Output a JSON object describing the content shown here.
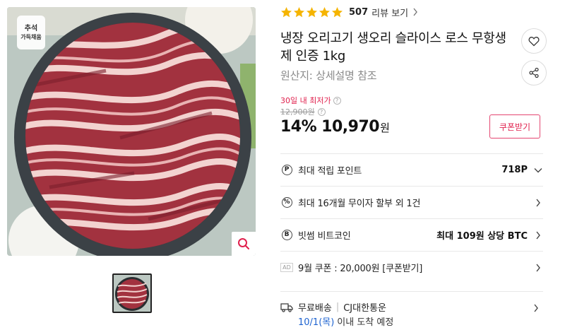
{
  "gallery": {
    "badge_line1": "추석",
    "badge_line2": "가득채움",
    "zoom_icon": "magnifier-icon"
  },
  "product": {
    "rating": 5,
    "review_count": "507",
    "review_link": "리뷰 보기",
    "title": "냉장 오리고기 생오리 슬라이스 로스 무항생제 인증 1kg",
    "origin": "원산지: 상세설명 참조",
    "lowest_label": "30일 내 최저가",
    "original_price": "12,900원",
    "discount": "14%",
    "price": "10,970",
    "currency": "원",
    "coupon_button": "쿠폰받기"
  },
  "benefits": [
    {
      "icon": "P",
      "label": "최대 적립 포인트",
      "value": "718P",
      "chevron": "down"
    },
    {
      "icon": "%",
      "label": "최대 16개월 무이자 할부 외 1건",
      "value": "",
      "chevron": "right"
    },
    {
      "icon": "B",
      "label": "빗썸 비트코인",
      "value": "최대 109원 상당 BTC",
      "chevron": "right"
    },
    {
      "icon": "AD",
      "label": "9월 쿠폰 : 20,000원 [쿠폰받기]",
      "value": "",
      "chevron": "right"
    }
  ],
  "shipping": {
    "label": "무료배송",
    "carrier": "CJ대한통운",
    "date": "10/1(목)",
    "date_suffix": "이내 도착 예정"
  },
  "colors": {
    "accent": "#e0204d",
    "star": "#f5b400",
    "date_blue": "#1e63d0"
  }
}
